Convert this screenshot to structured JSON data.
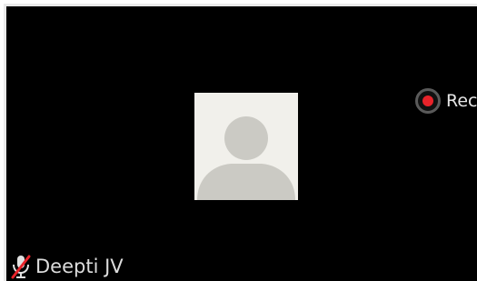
{
  "recording": {
    "label": "Rec",
    "icon": "record-icon",
    "indicator_color": "#e8232a"
  },
  "participant": {
    "name": "Deepti JV",
    "avatar": "default-user-avatar",
    "mic_icon": "mic-muted-icon",
    "muted": true
  },
  "colors": {
    "tile_background": "#000000",
    "avatar_background": "#f1f0eb",
    "avatar_silhouette": "#cbcac4",
    "muted_slash": "#e8232a"
  }
}
